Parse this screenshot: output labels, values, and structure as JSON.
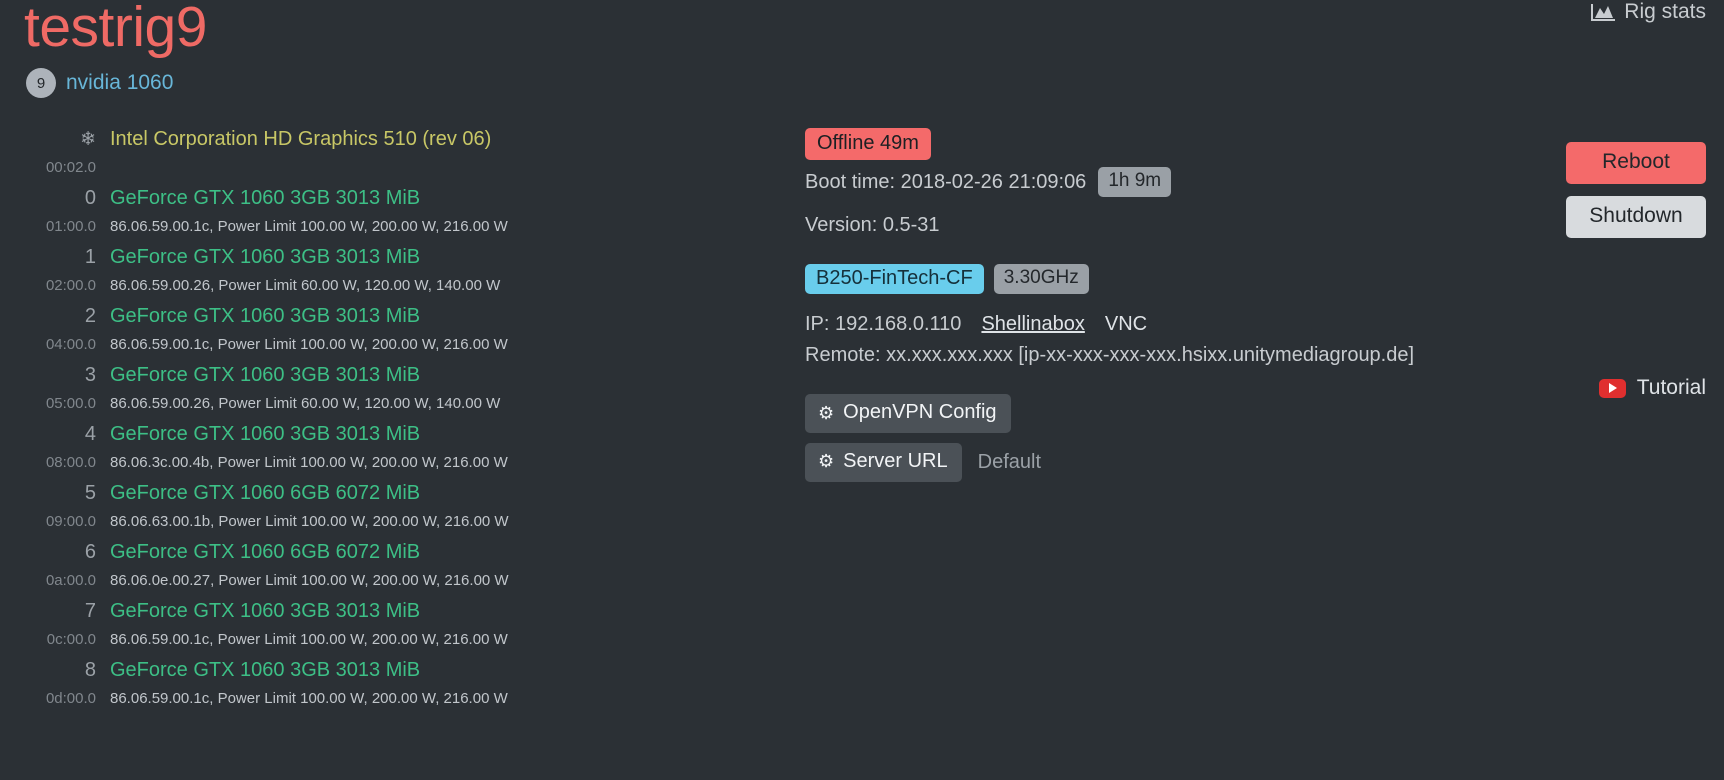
{
  "header": {
    "rig_name": "testrig9",
    "gpu_count": "9",
    "gpu_summary": "nvidia 1060",
    "rig_stats_label": "Rig stats",
    "rig_stats_icon": "area-chart-icon"
  },
  "gpu_list": [
    {
      "index": "",
      "icon": "snowflake-icon",
      "name": "Intel Corporation HD Graphics 510 (rev 06)",
      "busid": "00:02.0",
      "detail": "",
      "vendor": "intel"
    },
    {
      "index": "0",
      "name": "GeForce GTX 1060 3GB 3013 MiB",
      "busid": "01:00.0",
      "detail": "86.06.59.00.1c, Power Limit 100.00 W, 200.00 W, 216.00 W",
      "vendor": "nvidia"
    },
    {
      "index": "1",
      "name": "GeForce GTX 1060 3GB 3013 MiB",
      "busid": "02:00.0",
      "detail": "86.06.59.00.26, Power Limit 60.00 W, 120.00 W, 140.00 W",
      "vendor": "nvidia"
    },
    {
      "index": "2",
      "name": "GeForce GTX 1060 3GB 3013 MiB",
      "busid": "04:00.0",
      "detail": "86.06.59.00.1c, Power Limit 100.00 W, 200.00 W, 216.00 W",
      "vendor": "nvidia"
    },
    {
      "index": "3",
      "name": "GeForce GTX 1060 3GB 3013 MiB",
      "busid": "05:00.0",
      "detail": "86.06.59.00.26, Power Limit 60.00 W, 120.00 W, 140.00 W",
      "vendor": "nvidia"
    },
    {
      "index": "4",
      "name": "GeForce GTX 1060 3GB 3013 MiB",
      "busid": "08:00.0",
      "detail": "86.06.3c.00.4b, Power Limit 100.00 W, 200.00 W, 216.00 W",
      "vendor": "nvidia"
    },
    {
      "index": "5",
      "name": "GeForce GTX 1060 6GB 6072 MiB",
      "busid": "09:00.0",
      "detail": "86.06.63.00.1b, Power Limit 100.00 W, 200.00 W, 216.00 W",
      "vendor": "nvidia"
    },
    {
      "index": "6",
      "name": "GeForce GTX 1060 6GB 6072 MiB",
      "busid": "0a:00.0",
      "detail": "86.06.0e.00.27, Power Limit 100.00 W, 200.00 W, 216.00 W",
      "vendor": "nvidia"
    },
    {
      "index": "7",
      "name": "GeForce GTX 1060 3GB 3013 MiB",
      "busid": "0c:00.0",
      "detail": "86.06.59.00.1c, Power Limit 100.00 W, 200.00 W, 216.00 W",
      "vendor": "nvidia"
    },
    {
      "index": "8",
      "name": "GeForce GTX 1060 3GB 3013 MiB",
      "busid": "0d:00.0",
      "detail": "86.06.59.00.1c, Power Limit 100.00 W, 200.00 W, 216.00 W",
      "vendor": "nvidia"
    }
  ],
  "info": {
    "status_badge": "Offline 49m",
    "boot_time_label": "Boot time: 2018-02-26 21:09:06",
    "uptime_badge": "1h 9m",
    "version_label": "Version: 0.5-31",
    "motherboard_badge": "B250-FinTech-CF",
    "cpu_badge": "3.30GHz",
    "ip_label": "IP: 192.168.0.110",
    "shellinabox_label": "Shellinabox",
    "vnc_label": "VNC",
    "remote_label": "Remote: xx.xxx.xxx.xxx [ip-xx-xxx-xxx-xxx.hsixx.unitymediagroup.de]",
    "openvpn_button": "OpenVPN Config",
    "server_url_button": "Server URL",
    "server_url_value": "Default",
    "gear_icon": "gear-icon"
  },
  "actions": {
    "reboot_label": "Reboot",
    "shutdown_label": "Shutdown",
    "tutorial_label": "Tutorial",
    "tutorial_icon": "youtube-icon"
  },
  "colors": {
    "background": "#2b3035",
    "rig_name": "#ef6a65",
    "gpu_green": "#3dbf86",
    "intel_yellow": "#c8c766",
    "accent_blue": "#68b6d8",
    "offline_red": "#f46a6a",
    "badge_blue": "#69cdec",
    "badge_grey": "#9aa0a6"
  }
}
